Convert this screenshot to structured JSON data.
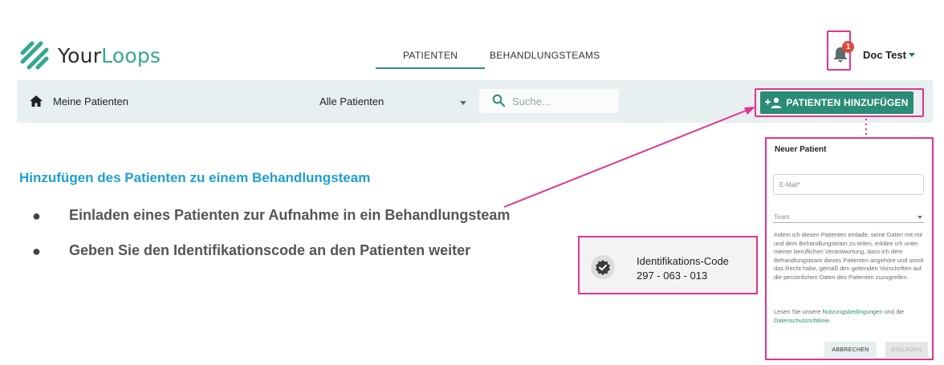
{
  "brand": {
    "logo_icon": "yourloops-logo-icon",
    "name_part1": "Your",
    "name_part2": "Loops",
    "accent_color": "#36a88f"
  },
  "nav": {
    "tabs": [
      {
        "label": "PATIENTEN",
        "active": true
      },
      {
        "label": "BEHANDLUNGSTEAMS",
        "active": false
      }
    ]
  },
  "user": {
    "notification_count": "1",
    "name": "Doc Test",
    "bell_icon": "bell-icon",
    "caret_icon": "caret-down-icon"
  },
  "toolbar": {
    "home_icon": "home-icon",
    "breadcrumb": "Meine Patienten",
    "filter_selected": "Alle Patienten",
    "search_placeholder": "Suche...",
    "add_patient_label": "PATIENTEN HINZUFÜGEN",
    "add_patient_icon": "person-add-icon",
    "primary_color": "#2b8c78",
    "toolbar_bg": "#e8eff0"
  },
  "annotation": {
    "heading": "Hinzufügen des Patienten zu einem Behandlungsteam",
    "bullets": [
      "Einladen eines Patienten zur Aufnahme in ein Behandlungsteam",
      "Geben Sie den Identifikationscode an den Patienten weiter"
    ],
    "highlight_color": "#e2338f",
    "heading_color": "#1e9fd4"
  },
  "id_card": {
    "icon": "verified-badge-icon",
    "title": "Identifikations-Code",
    "code": "297 - 063 - 013"
  },
  "dialog": {
    "title": "Neuer Patient",
    "email_label": "E-Mail*",
    "team_label": "Team",
    "consent_text": "Indem ich diesen Patienten einlade, seine Daten mit mir und dem Behandlungsteam zu teilen, erkläre ich unter meiner beruflichen Verantwortung, dass ich dem Behandlungsteam dieses Patienten angehöre und somit das Recht habe, gemäß den geltenden Vorschriften auf die persönlichen Daten des Patienten zuzugreifen.",
    "links_prefix": "Lesen Sie unsere ",
    "terms_link": "Nutzungsbedingungen",
    "links_middle": " und die ",
    "privacy_link": "Datenschutzrichtlinie",
    "links_suffix": ".",
    "cancel_label": "ABBRECHEN",
    "invite_label": "EINLADEN"
  }
}
